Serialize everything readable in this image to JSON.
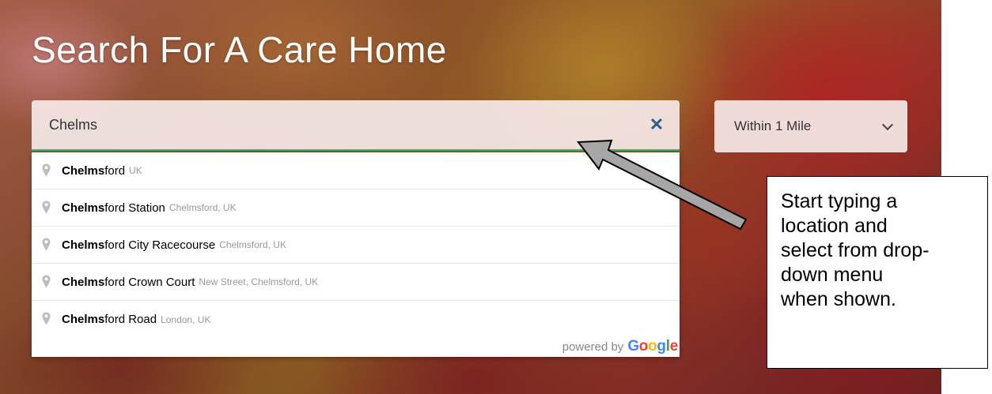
{
  "page": {
    "title": "Search For A Care Home"
  },
  "search": {
    "value": "Chelms",
    "clear_icon": "close-icon",
    "clear_glyph": "✕",
    "accent_color": "#3cb371"
  },
  "distance": {
    "selected": "Within 1 Mile",
    "icon": "chevron-down-icon"
  },
  "suggestions": [
    {
      "match": "Chelms",
      "rest": "ford",
      "secondary": "UK"
    },
    {
      "match": "Chelms",
      "rest": "ford Station",
      "secondary": "Chelmsford, UK"
    },
    {
      "match": "Chelms",
      "rest": "ford City Racecourse",
      "secondary": "Chelmsford, UK"
    },
    {
      "match": "Chelms",
      "rest": "ford Crown Court",
      "secondary": "New Street, Chelmsford, UK"
    },
    {
      "match": "Chelms",
      "rest": "ford Road",
      "secondary": "London, UK"
    }
  ],
  "attribution": {
    "prefix": "powered by",
    "brand": [
      "G",
      "o",
      "o",
      "g",
      "l",
      "e"
    ],
    "brand_colors": [
      "#4285F4",
      "#EA4335",
      "#FBBC05",
      "#4285F4",
      "#34A853",
      "#EA4335"
    ]
  },
  "callout": {
    "lines": [
      "Start typing a",
      "location and",
      "select from drop-",
      "down menu",
      "when shown."
    ]
  }
}
